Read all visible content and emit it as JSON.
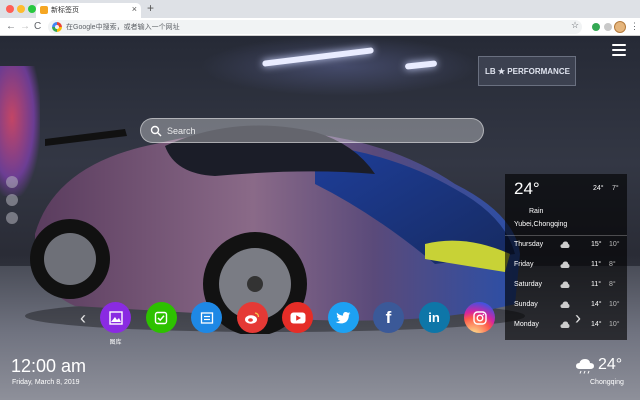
{
  "browser": {
    "tab_title": "新标签页",
    "tab_close": "×",
    "new_tab": "+",
    "omnibox_text": "在Google中搜索，或者输入一个网址",
    "back": "←",
    "forward": "→",
    "reload": "C",
    "star": "☆",
    "menu": "⋮"
  },
  "wallpaper": {
    "sign_text": "LB ★ PERFORMANCE"
  },
  "search": {
    "placeholder": "Search"
  },
  "weather": {
    "temp": "24°",
    "high": "24°",
    "low": "7°",
    "condition": "Rain",
    "location": "Yubei,Chongqing",
    "forecast": [
      {
        "day": "Thursday",
        "high": "15°",
        "low": "10°"
      },
      {
        "day": "Friday",
        "high": "11°",
        "low": "8°"
      },
      {
        "day": "Saturday",
        "high": "11°",
        "low": "8°"
      },
      {
        "day": "Sunday",
        "high": "14°",
        "low": "10°"
      },
      {
        "day": "Monday",
        "high": "14°",
        "low": "10°"
      }
    ]
  },
  "shortcuts": {
    "prev": "‹",
    "next": "›",
    "items": [
      {
        "name": "gallery",
        "label": "图库",
        "color": "#8a2be2",
        "glyph": ""
      },
      {
        "name": "wechat",
        "label": "",
        "color": "#2dc100",
        "glyph": ""
      },
      {
        "name": "notes",
        "label": "",
        "color": "#1e88e5",
        "glyph": ""
      },
      {
        "name": "weibo",
        "label": "",
        "color": "#e53935",
        "glyph": ""
      },
      {
        "name": "youtube",
        "label": "",
        "color": "#e52d27",
        "glyph": ""
      },
      {
        "name": "twitter",
        "label": "",
        "color": "#1da1f2",
        "glyph": ""
      },
      {
        "name": "facebook",
        "label": "",
        "color": "#3b5998",
        "glyph": "f"
      },
      {
        "name": "linkedin",
        "label": "",
        "color": "#0e76a8",
        "glyph": "in"
      },
      {
        "name": "instagram",
        "label": "",
        "color": "#d6249f",
        "glyph": ""
      }
    ]
  },
  "clock": {
    "time": "12:00 am",
    "date": "Friday, March 8, 2019"
  },
  "bottom_weather": {
    "temp": "24°",
    "location": "Chongqing"
  },
  "colors": {
    "chrome_bg": "#dee1e6",
    "panel_bg": "rgba(0,0,0,0.62)",
    "car_body": "#7a5a78",
    "car_hood": "#2a4fa8"
  }
}
